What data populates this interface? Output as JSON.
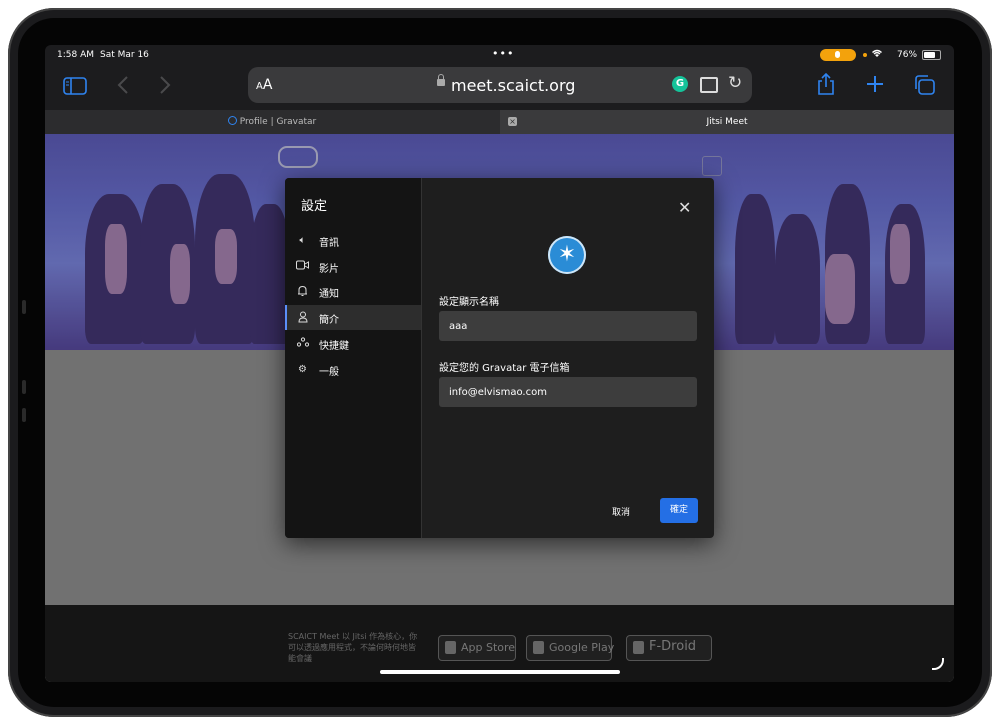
{
  "status_bar": {
    "time": "1:58 AM",
    "date": "Sat Mar 16",
    "battery": "76%",
    "icons": [
      "microphone-icon",
      "wifi-icon",
      "battery-icon"
    ]
  },
  "browser": {
    "text_size": "AA",
    "url": "meet.scaict.org",
    "grammarly_badge": "G",
    "tabs": [
      {
        "label": "Profile | Gravatar",
        "active": false
      },
      {
        "label": "Jitsi Meet",
        "active": true
      }
    ]
  },
  "settings": {
    "title": "設定",
    "nav": [
      {
        "label": "音訊",
        "icon": "speaker-icon"
      },
      {
        "label": "影片",
        "icon": "video-icon"
      },
      {
        "label": "通知",
        "icon": "bell-icon"
      },
      {
        "label": "簡介",
        "icon": "person-icon",
        "selected": true
      },
      {
        "label": "快捷鍵",
        "icon": "shortcut-icon"
      },
      {
        "label": "一般",
        "icon": "gear-icon"
      }
    ],
    "profile": {
      "display_name_label": "設定顯示名稱",
      "display_name_value": "aaa",
      "gravatar_label": "設定您的 Gravatar 電子信箱",
      "gravatar_value": "info@elvismao.com"
    },
    "cancel_label": "取消",
    "ok_label": "確定"
  },
  "footer": {
    "text": "SCAICT Meet 以 Jitsi 作為核心，你可以透過應用程式，不論何時何地皆能會議",
    "stores": [
      "App Store",
      "Google Play",
      "F-Droid"
    ]
  },
  "colors": {
    "accent": "#246fe5",
    "selection": "#5b8ff9",
    "safari_blue": "#2f84f0"
  }
}
